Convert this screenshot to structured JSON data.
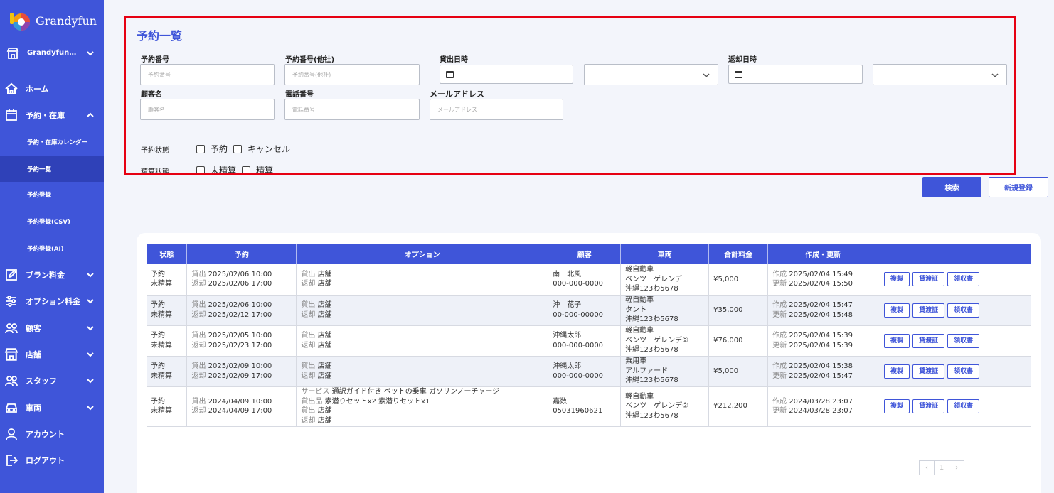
{
  "app": {
    "name": "Grandyfun",
    "store": "Grandyfun…"
  },
  "sidebar": {
    "items": [
      {
        "label": "ホーム"
      },
      {
        "label": "予約・在庫"
      },
      {
        "label": "プラン料金"
      },
      {
        "label": "オプション料金"
      },
      {
        "label": "顧客"
      },
      {
        "label": "店舗"
      },
      {
        "label": "スタッフ"
      },
      {
        "label": "車両"
      },
      {
        "label": "アカウント"
      },
      {
        "label": "ログアウト"
      }
    ],
    "subitems": [
      {
        "label": "予約・在庫カレンダー"
      },
      {
        "label": "予約一覧"
      },
      {
        "label": "予約登録"
      },
      {
        "label": "予約登録(CSV)"
      },
      {
        "label": "予約登録(AI)"
      }
    ]
  },
  "page": {
    "title": "予約一覧"
  },
  "filters": {
    "reservation_no": {
      "label": "予約番号",
      "placeholder": "予約番号"
    },
    "reservation_no_other": {
      "label": "予約番号(他社)",
      "placeholder": "予約番号(他社)"
    },
    "rent_date": {
      "label": "貸出日時"
    },
    "return_date": {
      "label": "返却日時"
    },
    "customer_name": {
      "label": "顧客名",
      "placeholder": "顧客名"
    },
    "phone": {
      "label": "電話番号",
      "placeholder": "電話番号"
    },
    "email": {
      "label": "メールアドレス",
      "placeholder": "メールアドレス"
    },
    "reservation_status": {
      "label": "予約状態",
      "options": [
        "予約",
        "キャンセル"
      ]
    },
    "payment_status": {
      "label": "精算状態",
      "options": [
        "未精算",
        "精算"
      ]
    }
  },
  "buttons": {
    "search": "検索",
    "new": "新規登録"
  },
  "table": {
    "headers": [
      "状態",
      "予約",
      "オプション",
      "顧客",
      "車両",
      "合計料金",
      "作成・更新",
      ""
    ],
    "rows": [
      {
        "status": [
          "予約",
          "未精算"
        ],
        "rent_label": "貸出",
        "rent": "2025/02/06 10:00",
        "return_label": "返却",
        "return": "2025/02/06 17:00",
        "options": [
          [
            "貸出",
            "店舗"
          ],
          [
            "返却",
            "店舗"
          ]
        ],
        "customer": [
          "南　北風",
          "000-000-0000"
        ],
        "vehicle": [
          "軽自動車",
          "ベンツ　ゲレンデ",
          "沖縄123わ5678"
        ],
        "total": "¥5,000",
        "created_label": "作成",
        "created": "2025/02/04 15:49",
        "updated_label": "更新",
        "updated": "2025/02/04 15:50"
      },
      {
        "status": [
          "予約",
          "未精算"
        ],
        "rent_label": "貸出",
        "rent": "2025/02/06 10:00",
        "return_label": "返却",
        "return": "2025/02/12 17:00",
        "options": [
          [
            "貸出",
            "店舗"
          ],
          [
            "返却",
            "店舗"
          ]
        ],
        "customer": [
          "沖　花子",
          "00-000-00000"
        ],
        "vehicle": [
          "軽自動車",
          "タント",
          "沖縄123わ5678"
        ],
        "total": "¥35,000",
        "created_label": "作成",
        "created": "2025/02/04 15:47",
        "updated_label": "更新",
        "updated": "2025/02/04 15:48"
      },
      {
        "status": [
          "予約",
          "未精算"
        ],
        "rent_label": "貸出",
        "rent": "2025/02/05 10:00",
        "return_label": "返却",
        "return": "2025/02/23 17:00",
        "options": [
          [
            "貸出",
            "店舗"
          ],
          [
            "返却",
            "店舗"
          ]
        ],
        "customer": [
          "沖縄太郎",
          "000-000-0000"
        ],
        "vehicle": [
          "軽自動車",
          "ベンツ　ゲレンデ②",
          "沖縄123わ5678"
        ],
        "total": "¥76,000",
        "created_label": "作成",
        "created": "2025/02/04 15:39",
        "updated_label": "更新",
        "updated": "2025/02/04 15:39"
      },
      {
        "status": [
          "予約",
          "未精算"
        ],
        "rent_label": "貸出",
        "rent": "2025/02/09 10:00",
        "return_label": "返却",
        "return": "2025/02/09 17:00",
        "options": [
          [
            "貸出",
            "店舗"
          ],
          [
            "返却",
            "店舗"
          ]
        ],
        "customer": [
          "沖縄太郎",
          "000-000-0000"
        ],
        "vehicle": [
          "乗用車",
          "アルファード",
          "沖縄123わ5678"
        ],
        "total": "¥5,000",
        "created_label": "作成",
        "created": "2025/02/04 15:38",
        "updated_label": "更新",
        "updated": "2025/02/04 15:47"
      },
      {
        "status": [
          "予約",
          "未精算"
        ],
        "rent_label": "貸出",
        "rent": "2024/04/09 10:00",
        "return_label": "返却",
        "return": "2024/04/09 17:00",
        "options": [
          [
            "サービス",
            "通訳ガイド付き ペットの乗車 ガソリンノーチャージ"
          ],
          [
            "貸出品",
            "素潜りセットx2 素潜りセットx1"
          ],
          [
            "貸出",
            "店舗"
          ],
          [
            "返却",
            "店舗"
          ]
        ],
        "customer": [
          "嘉数",
          "05031960621"
        ],
        "vehicle": [
          "軽自動車",
          "ベンツ　ゲレンデ②",
          "沖縄123わ5678"
        ],
        "total": "¥212,200",
        "created_label": "作成",
        "created": "2024/03/28 23:07",
        "updated_label": "更新",
        "updated": "2024/03/28 23:07"
      }
    ],
    "actions": [
      "複製",
      "貸渡証",
      "領収書"
    ]
  },
  "pagination": {
    "prev": "‹",
    "current": "1",
    "next": "›"
  },
  "colors": {
    "primary": "#3f55d9",
    "highlight": "#e60012"
  }
}
